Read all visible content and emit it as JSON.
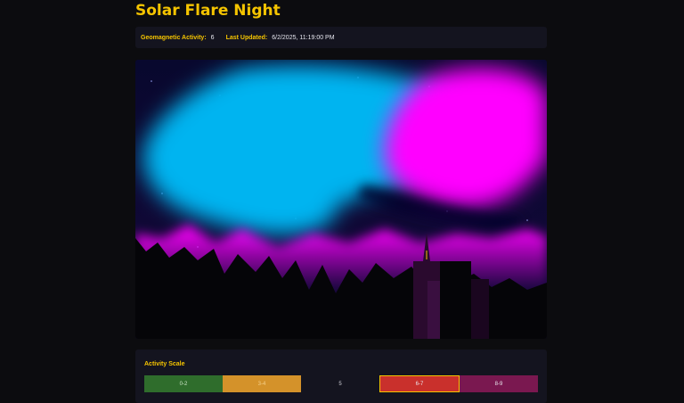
{
  "page": {
    "title": "Solar Flare Night"
  },
  "status": {
    "activity_label": "Geomagnetic Activity:",
    "activity_value": "6",
    "updated_label": "Last Updated:",
    "updated_value": "6/2/2025, 11:19:00 PM"
  },
  "scene": {
    "aurora_colors": [
      "#00b4f0",
      "#ff00ff"
    ],
    "sky_color": "#06062a",
    "glow_color": "#ff00ff",
    "activity_level": 6
  },
  "scale": {
    "title": "Activity Scale",
    "segments": [
      {
        "label": "0-2",
        "color": "#2f6d2c"
      },
      {
        "label": "3-4",
        "color": "#d4922a"
      },
      {
        "label": "5",
        "color": "transparent"
      },
      {
        "label": "6-7",
        "color": "#c9302c",
        "active": true
      },
      {
        "label": "8-9",
        "color": "#7a1850"
      }
    ]
  }
}
